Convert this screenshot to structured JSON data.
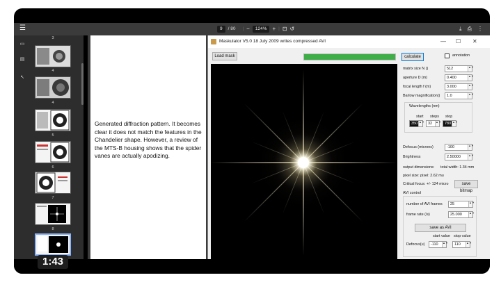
{
  "viewer": {
    "page_current": "9",
    "page_total": "/ 80",
    "zoom": "124%"
  },
  "thumbnails": [
    {
      "num": "3"
    },
    {
      "num": "4"
    },
    {
      "num": "5"
    },
    {
      "num": "6"
    },
    {
      "num": "7"
    },
    {
      "num": "8"
    },
    {
      "num": "9"
    }
  ],
  "page_text": "Generated diffraction pattern. It becomes clear it does not match the features in the Chandelier shape. However, a review of the MTS-B housing shows that the spider vanes are actually apodizing.",
  "app": {
    "title": "Maskulator V5.0    18 July 2009  writes compressed AVI",
    "load_mask": "Load mask",
    "progress": 1.0,
    "calculate": "calculate",
    "annotation": "annotation",
    "params": [
      {
        "label": "matrix size N ()",
        "value": "512"
      },
      {
        "label": "aperture D (m)",
        "value": "0.400"
      },
      {
        "label": "focal length f (m)",
        "value": "3.000"
      },
      {
        "label": "Barlow magnification()",
        "value": "1.0"
      }
    ],
    "wavelengths": {
      "title": "Wavelengths (nm)",
      "start_label": "start",
      "steps_label": "steps",
      "stop_label": "stop",
      "start": "350",
      "steps": "32",
      "stop": "780"
    },
    "defocus_label": "Defocus (microns)",
    "defocus": "-100",
    "brightness_label": "Brightness",
    "brightness": "2.50000",
    "output_dimensions": "output dimensions:",
    "total_width": "total width:  1.34 mm",
    "pixel_size": "pixel size:  pixel: 2.62 mu",
    "critical_focus": "Critical focus:  +/- 124 micro",
    "save_bitmap": "save bitmap",
    "avi_control": "AVI control",
    "avi_frames_label": "number of AVI frames",
    "avi_frames": "25",
    "frame_rate_label": "frame rate (/s)",
    "frame_rate": "25.000",
    "save_avi": "save as AVI",
    "start_value": "start value",
    "stop_value": "stop value",
    "defocus_u_label": "Defocus(u)",
    "defocus_start": "-110",
    "defocus_stop": "110"
  },
  "video": {
    "time": "1:43"
  },
  "colors": {
    "progress": "#3fae49",
    "accent": "#0078d7"
  }
}
